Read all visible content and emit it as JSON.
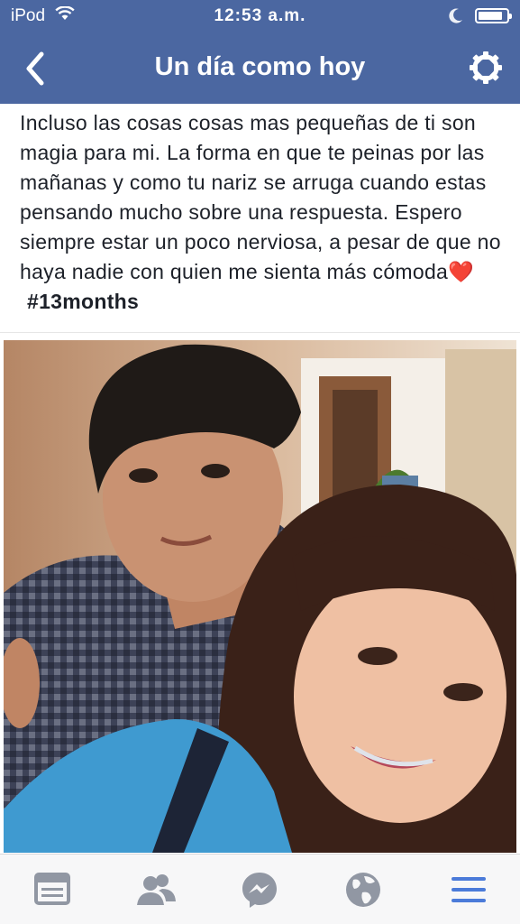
{
  "status_bar": {
    "carrier": "iPod",
    "time": "12:53 a.m.",
    "battery_level": 0.85
  },
  "navbar": {
    "title": "Un día como hoy",
    "back_icon": "chevron-left-icon",
    "settings_icon": "gear-icon"
  },
  "post": {
    "text": "Incluso las cosas cosas mas pequeñas de ti son magia para mi. La forma en que te peinas por las mañanas y como tu nariz se arruga cuando estas pensando mucho sobre una respuesta. Espero siempre estar un poco nerviosa, a pesar de que no haya nadie con quien me sienta más cómoda",
    "emoji": "❤️",
    "hashtag": "#13months"
  },
  "tabbar": {
    "tabs": [
      {
        "icon": "news-feed-icon",
        "active": false
      },
      {
        "icon": "friends-icon",
        "active": false
      },
      {
        "icon": "messenger-icon",
        "active": false
      },
      {
        "icon": "globe-icon",
        "active": false
      },
      {
        "icon": "menu-icon",
        "active": true
      }
    ]
  },
  "colors": {
    "brand": "#4b67a1",
    "tab_inactive": "#9197a3",
    "tab_active": "#4b7bd9"
  }
}
